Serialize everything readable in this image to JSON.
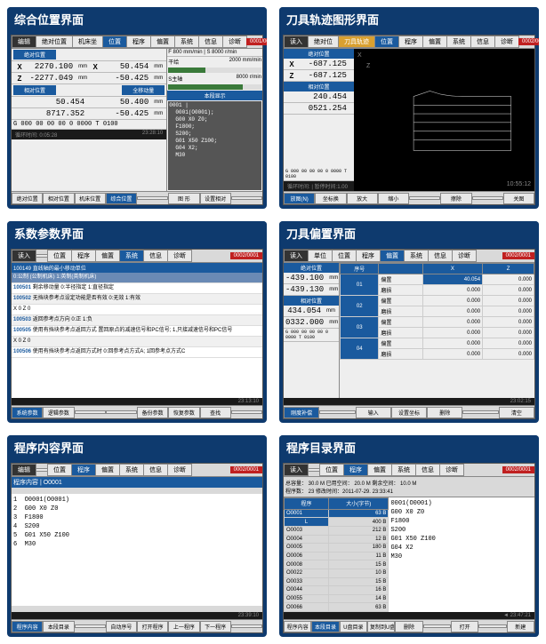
{
  "panels": {
    "p1": {
      "title": "综合位置界面",
      "tabs": [
        "编辑",
        "绝对位置",
        "机床坐",
        "位置",
        "程序",
        "偏置",
        "系统",
        "信息",
        "诊断"
      ],
      "badge": "0001/0001",
      "abs_label": "绝对位置",
      "rel_label": "相对位置",
      "all_label": "全移动量",
      "rows": [
        {
          "ax": "X",
          "v": "2270.100",
          "u": "mm"
        },
        {
          "ax": "Z",
          "v": "-2277.049",
          "u": "mm"
        }
      ],
      "side_rows": [
        {
          "ax": "X",
          "v": "50.454",
          "u": "mm"
        },
        {
          "ax": "Z",
          "v": "-50.425",
          "u": "mm"
        }
      ],
      "mid_rows": [
        {
          "ax": "",
          "v": "50.454",
          "v2": "50.400",
          "u": "mm"
        },
        {
          "ax": "",
          "v": "8717.352",
          "v2": "-50.425",
          "u": "mm"
        }
      ],
      "g_codes": "G 000 00 00 00 0 0000    T 0100",
      "status_left": "循环时间: 0:05:28",
      "side": {
        "feed": "F         800 mm/min | S    8000 r/min",
        "f_lbl": "干给",
        "f_bar": "2000 mm/min",
        "s_lbl": "S主轴",
        "s_bar": "8000 r/min",
        "prog_label": "本段显示",
        "prog": "0001 |\n  0001(O0001);\n  G00 X0 Z0;\n  F1800;\n  S200;\n  G01 X50 Z100;\n  G04 X2;\n  M30"
      },
      "time": "23:28:10",
      "footer": [
        "绝对位置",
        "相对位置",
        "机床位置",
        "综合位置",
        "",
        "图 形",
        "设置相对",
        "",
        "",
        ""
      ]
    },
    "p2": {
      "title": "刀具轨迹图形界面",
      "tabs": [
        "读入",
        "绝对位",
        "刀具轨迹",
        "位置",
        "程序",
        "偏置",
        "系统",
        "信息",
        "诊断"
      ],
      "badge": "0002/0001",
      "axis_label": "绝对位置",
      "rows": [
        {
          "ax": "X",
          "v": "-687.125",
          "u": "mm"
        },
        {
          "ax": "Z",
          "v": "-687.125",
          "u": "mm"
        }
      ],
      "rel_label": "相对位置",
      "rel_rows": [
        {
          "ax": "",
          "v": "240.454",
          "u": "mm"
        },
        {
          "ax": "",
          "v": "0521.254",
          "u": "mm"
        }
      ],
      "g_codes": "G 000 00 00 00 0 0000   T 0100",
      "status": "循环时间:       | 暂停时间:1.00",
      "time": "10:55:12",
      "footer": [
        "放图(N)",
        "坐标换",
        "放大",
        "缩小",
        "",
        "擦除",
        "",
        "",
        "关图"
      ]
    },
    "p3": {
      "title": "系数参数界面",
      "tabs": [
        "读入",
        "",
        "位置",
        "程序",
        "偏置",
        "系统",
        "信息",
        "诊断"
      ],
      "badge": "0002/0001",
      "header": "100149   直线轴的最小移动单位",
      "sub": "0:公制 (公制机床) 1:英制(英制机床)",
      "items": [
        {
          "id": "100501",
          "t": "剩余移动量\n         0:半径指定  1:直径指定"
        },
        {
          "id": "100502",
          "t": "无挡块参考点设定功能是否有效\n         0:无效  1:有效"
        },
        {
          "id": "",
          "t": "X   0\nZ   0"
        },
        {
          "id": "100503",
          "t": "返回参考点方向\n         0:正  1:负"
        },
        {
          "id": "100505",
          "t": "使用有挡块参考点返回方式\n         置回原点的减速信号和PC信号; 1,只接减速信号和PC信号"
        },
        {
          "id": "",
          "t": "X   0\nZ   0"
        },
        {
          "id": "100506",
          "t": "使用有挡块参考点返回方式时\n         0:回参考点方式A; 1回参考点方式C"
        }
      ],
      "time": "23:13:10",
      "footer": [
        "系统参数",
        "逻辑参数",
        "",
        "",
        "备份参数",
        "恢复参数",
        "查找",
        "",
        "",
        ""
      ]
    },
    "p4": {
      "title": "刀具偏置界面",
      "tabs": [
        "读入",
        "单位",
        "位置",
        "程序",
        "偏置",
        "系统",
        "信息",
        "诊断"
      ],
      "badge": "0002/0001",
      "side_label": "绝对位置",
      "side_rows": [
        {
          "id": "1",
          "v": "-439.100",
          "u": "mm"
        },
        {
          "id": "2",
          "v": "-439.130",
          "u": "mm"
        }
      ],
      "rel_label": "相对位置",
      "rel_rows": [
        {
          "id": "",
          "v": "434.054",
          "u": "mm"
        },
        {
          "id": "",
          "v": "0332.000",
          "u": "mm"
        }
      ],
      "g_codes": "G 000 00 00 00 0 0000  T 0100",
      "th": [
        "序号",
        "",
        "X",
        "Z"
      ],
      "rows": [
        [
          "01",
          "偏置",
          "40.054",
          "0.000"
        ],
        [
          "",
          "磨损",
          "0.000",
          "0.000"
        ],
        [
          "02",
          "偏置",
          "0.000",
          "0.000"
        ],
        [
          "",
          "磨损",
          "0.000",
          "0.000"
        ],
        [
          "03",
          "偏置",
          "0.000",
          "0.000"
        ],
        [
          "",
          "磨损",
          "0.000",
          "0.000"
        ],
        [
          "04",
          "偏置",
          "0.000",
          "0.000"
        ],
        [
          "",
          "磨损",
          "0.000",
          "0.000"
        ]
      ],
      "time": "23:02:15",
      "footer": [
        "刚度补偿",
        "",
        "输入",
        "设置坐标",
        "删除",
        "",
        "清空"
      ]
    },
    "p5": {
      "title": "程序内容界面",
      "tabs": [
        "编辑",
        "",
        "位置",
        "程序",
        "偏置",
        "系统",
        "信息",
        "诊断"
      ],
      "badge": "0002/0001",
      "header": "程序内容 | O0001",
      "code": "1  O0001(O0001)\n2  G00 X0 Z0\n3  F1800\n4  S200\n5  G01 X50 Z100\n6  M30",
      "time": "23:39:10",
      "footer": [
        "程序内容",
        "本段目录",
        "",
        "自动序号",
        "打开程序",
        "上一程序",
        "下一程序",
        "",
        "",
        ""
      ]
    },
    "p6": {
      "title": "程序目录界面",
      "tabs": [
        "读入",
        "",
        "位置",
        "程序",
        "偏置",
        "系统",
        "信息",
        "诊断"
      ],
      "badge": "0002/0001",
      "top": {
        "a": "总容量：  30.0 M     已用空间：  20.0 M     剩余空间：  10.0 M",
        "b": "程序数：    23                    修改时间：2011-07-29. 23:33:41"
      },
      "th": [
        "程序",
        "大小(字节)"
      ],
      "rows": [
        [
          "O0001",
          "63 B",
          "0001(O0001)"
        ],
        [
          "L",
          "400 B",
          "G00 X0 Z0"
        ],
        [
          "O0003",
          "212 B",
          "F1800"
        ],
        [
          "O0004",
          "12 B",
          "S200"
        ],
        [
          "O0005",
          "180 B",
          "G01 X50 Z100"
        ],
        [
          "O0006",
          "11 B",
          "G04 X2"
        ],
        [
          "O0008",
          "15 B",
          "M30"
        ],
        [
          "O0022",
          "10 B",
          ""
        ],
        [
          "O0033",
          "15 B",
          ""
        ],
        [
          "O0044",
          "16 B",
          ""
        ],
        [
          "O0055",
          "14 B",
          ""
        ],
        [
          "O0066",
          "63 B",
          ""
        ]
      ],
      "time": "23:47:21",
      "footer": [
        "程序内容",
        "本段目录",
        "U盘目录",
        "复制到U盘",
        "删除",
        "",
        "打开",
        "",
        "新建"
      ]
    }
  }
}
